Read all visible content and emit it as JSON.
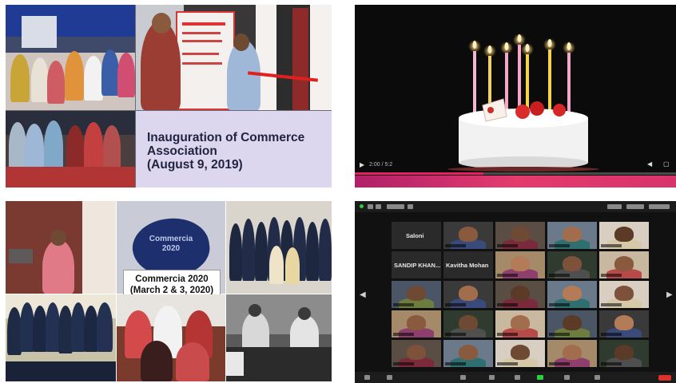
{
  "panels": {
    "inauguration": {
      "caption_lines": [
        "Inauguration of Commerce",
        "Association",
        "(August 9, 2019)"
      ]
    },
    "birthday_video": {
      "video_time": "2:00 / 5:2"
    },
    "commercia": {
      "logo_text": "Commercia\n2020",
      "caption_lines": [
        "Commercia 2020",
        "(March 2 & 3, 2020)"
      ]
    },
    "zoom_call": {
      "participants": [
        "Saloni",
        "SANDIP KHAN...",
        "Kavitha Mohan"
      ]
    }
  },
  "colors": {
    "caption_bg": "#dcd7ee",
    "caption_text": "#1f2340",
    "ribbon": "#e02020",
    "video_progress": "#e91e63",
    "zoom_bg": "#111111"
  }
}
